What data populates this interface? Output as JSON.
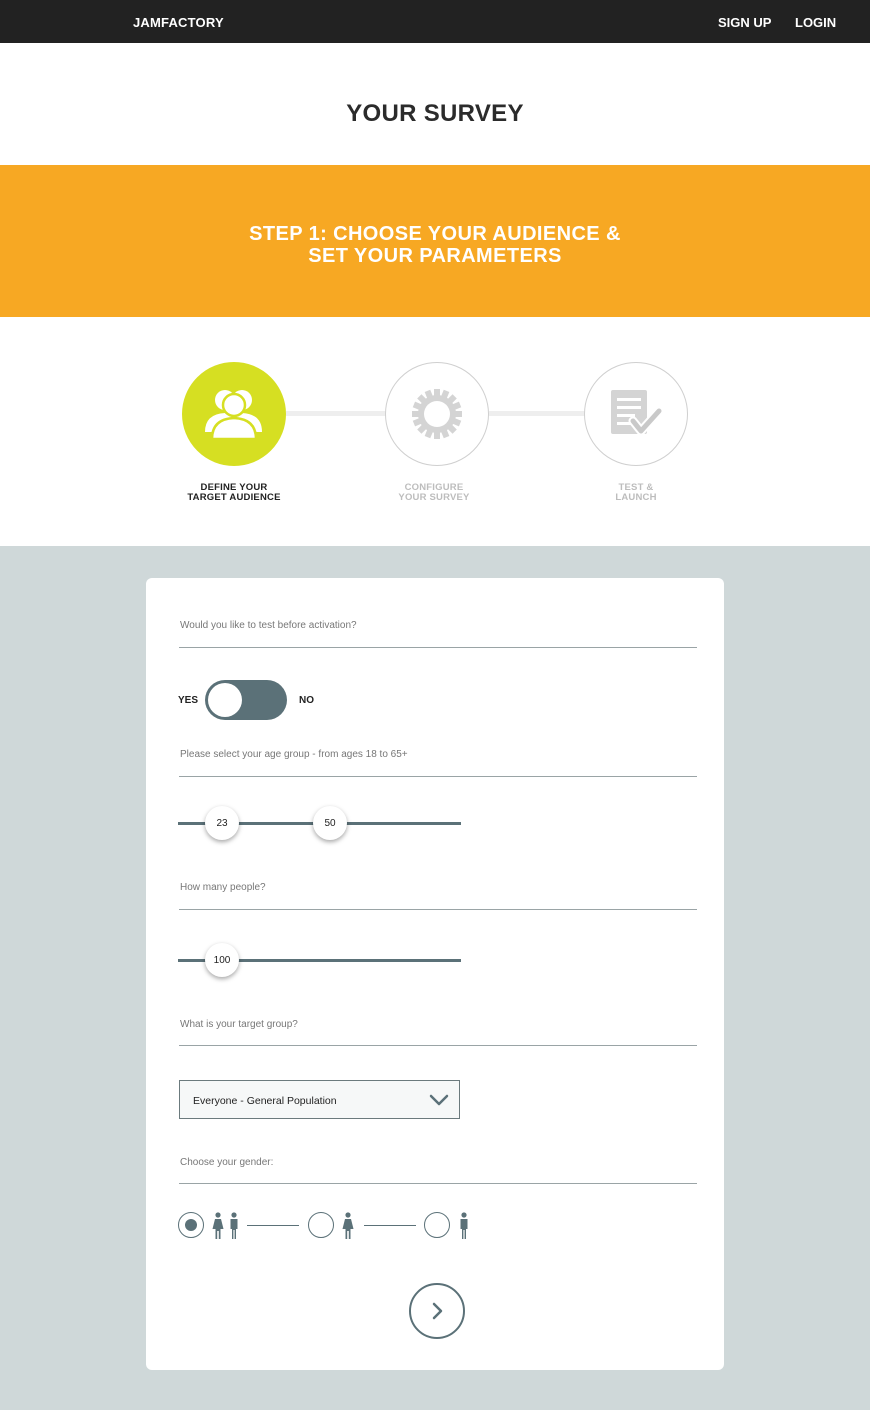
{
  "header": {
    "brand": "JAMFACTORY",
    "nav": {
      "signup": "SIGN UP",
      "login": "LOGIN"
    }
  },
  "page_title": "YOUR SURVEY",
  "step_banner": {
    "line1": "STEP 1: CHOOSE YOUR AUDIENCE &",
    "line2": "SET YOUR PARAMETERS"
  },
  "steps": [
    {
      "line1": "DEFINE YOUR",
      "line2": "TARGET AUDIENCE",
      "icon": "users-icon",
      "state": "active"
    },
    {
      "line1": "CONFIGURE",
      "line2": "YOUR SURVEY",
      "icon": "gear-icon",
      "state": "inactive"
    },
    {
      "line1": "TEST &",
      "line2": "LAUNCH",
      "icon": "checklist-icon",
      "state": "inactive"
    }
  ],
  "form": {
    "test_question": "Would you like to test before activation?",
    "toggle": {
      "yes": "YES",
      "no": "NO",
      "selected": "YES"
    },
    "age_question": "Please select your age group - from ages 18 to 65+",
    "age_range": {
      "min_label": "23",
      "max_label": "50",
      "min": 23,
      "max": 50,
      "range_min": 18,
      "range_max": 65
    },
    "people_question": "How many people?",
    "people": {
      "label": "100",
      "value": 100
    },
    "target_question": "What is your target group?",
    "target_group": {
      "selected": "Everyone - General Population"
    },
    "gender_question": "Choose your gender:",
    "gender_options": [
      {
        "icon": "female-male-icon",
        "selected": true
      },
      {
        "icon": "female-icon",
        "selected": false
      },
      {
        "icon": "male-icon",
        "selected": false
      }
    ],
    "next_icon": "chevron-right-icon"
  },
  "colors": {
    "header_bg": "#222222",
    "banner_orange": "#f7a823",
    "active_step": "#d6df22",
    "control_slate": "#5b7178",
    "page_bg": "#cfd8d9"
  }
}
